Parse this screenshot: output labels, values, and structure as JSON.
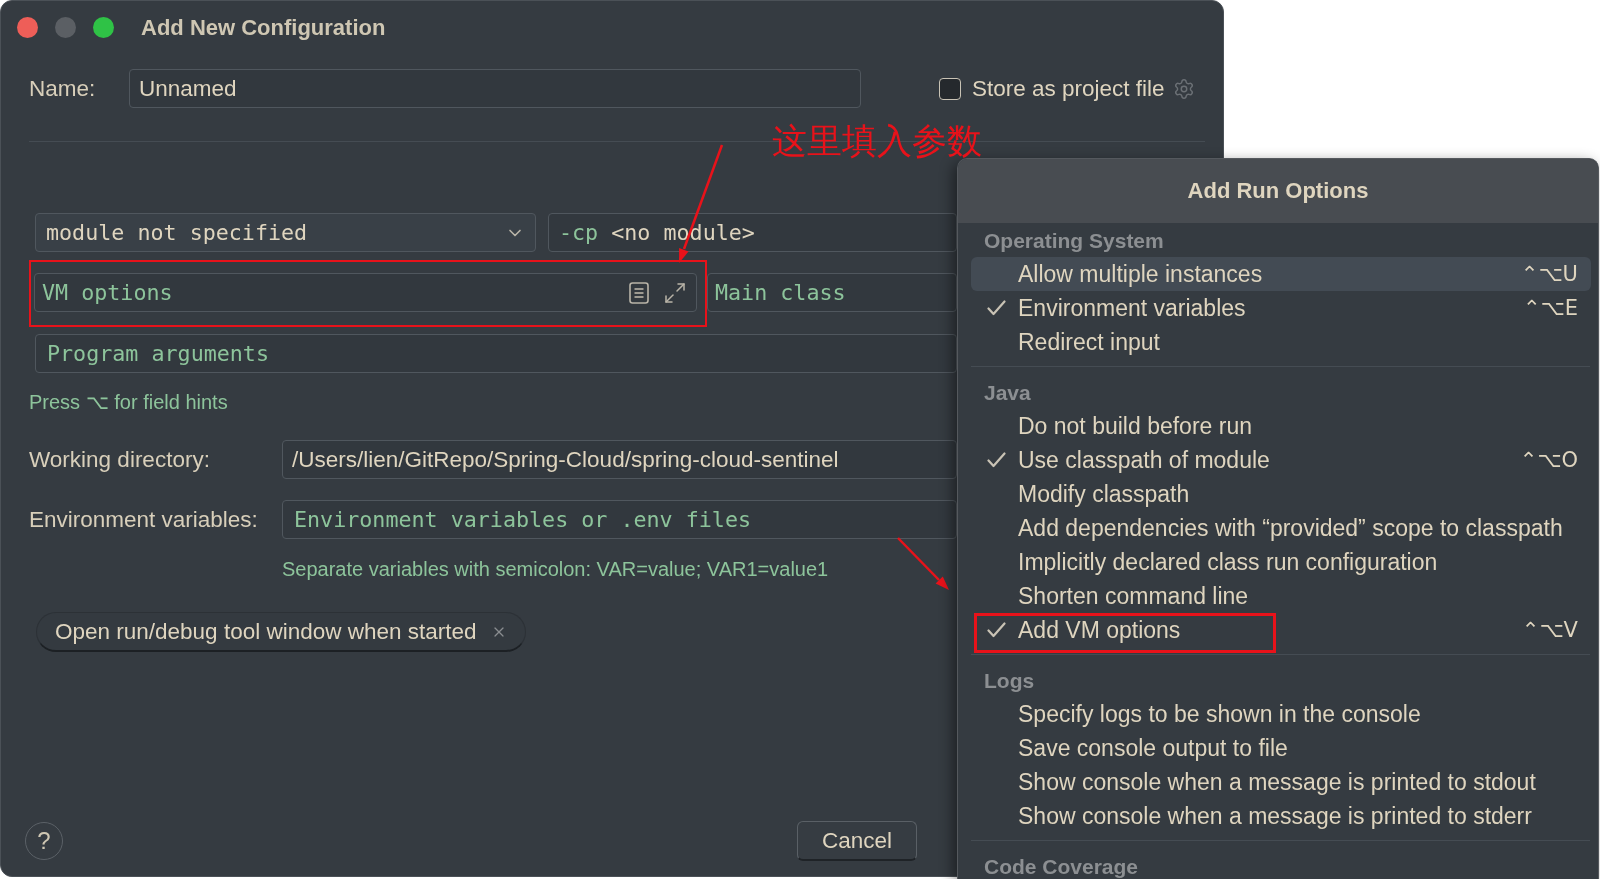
{
  "window": {
    "title": "Add New Configuration",
    "controls": [
      {
        "kind": "close",
        "disabled": false
      },
      {
        "kind": "minimize",
        "disabled": true
      },
      {
        "kind": "zoom",
        "disabled": false
      }
    ]
  },
  "name_field": {
    "label": "Name:",
    "value": "Unnamed"
  },
  "store_as_project_file": {
    "label": "Store as project file",
    "checked": false
  },
  "annotation": {
    "text": "这里填入参数"
  },
  "module_select": {
    "value": "module not specified"
  },
  "classpath_field": {
    "flag": "-cp",
    "value": "<no module>"
  },
  "vm_options_field": {
    "placeholder": "VM options",
    "annotated": true
  },
  "main_class_field": {
    "placeholder": "Main class"
  },
  "program_arguments_field": {
    "placeholder": "Program arguments"
  },
  "field_hints_note": "Press ⌥ for field hints",
  "working_directory": {
    "label": "Working directory:",
    "value": "/Users/lien/GitRepo/Spring-Cloud/spring-cloud-sentinel"
  },
  "environment_variables": {
    "label": "Environment variables:",
    "placeholder": "Environment variables or .env files",
    "hint": "Separate variables with semicolon: VAR=value; VAR1=value1"
  },
  "option_chips": [
    {
      "label": "Open run/debug tool window when started"
    }
  ],
  "help_button": {
    "label": "?"
  },
  "buttons": [
    {
      "label": "Cancel"
    }
  ],
  "run_options": {
    "title": "Add Run Options",
    "groups": [
      {
        "title": "Operating System",
        "items": [
          {
            "label": "Allow multiple instances",
            "shortcut": "⌃⌥U",
            "selected": true,
            "checked": false,
            "annotated": false
          },
          {
            "label": "Environment variables",
            "shortcut": "⌃⌥E",
            "selected": false,
            "checked": true,
            "annotated": false
          },
          {
            "label": "Redirect input",
            "selected": false,
            "checked": false,
            "annotated": false
          }
        ]
      },
      {
        "title": "Java",
        "items": [
          {
            "label": "Do not build before run",
            "selected": false,
            "checked": false,
            "annotated": false
          },
          {
            "label": "Use classpath of module",
            "shortcut": "⌃⌥O",
            "selected": false,
            "checked": true,
            "annotated": false
          },
          {
            "label": "Modify classpath",
            "selected": false,
            "checked": false,
            "annotated": false
          },
          {
            "label": "Add dependencies with “provided” scope to classpath",
            "selected": false,
            "checked": false,
            "annotated": false
          },
          {
            "label": "Implicitly declared class run configuration",
            "selected": false,
            "checked": false,
            "annotated": false
          },
          {
            "label": "Shorten command line",
            "selected": false,
            "checked": false,
            "annotated": false
          },
          {
            "label": "Add VM options",
            "shortcut": "⌃⌥V",
            "selected": false,
            "checked": true,
            "annotated": true
          }
        ]
      },
      {
        "title": "Logs",
        "items": [
          {
            "label": "Specify logs to be shown in the console",
            "selected": false,
            "checked": false,
            "annotated": false
          },
          {
            "label": "Save console output to file",
            "selected": false,
            "checked": false,
            "annotated": false
          },
          {
            "label": "Show console when a message is printed to stdout",
            "selected": false,
            "checked": false,
            "annotated": false
          },
          {
            "label": "Show console when a message is printed to stderr",
            "selected": false,
            "checked": false,
            "annotated": false
          }
        ]
      },
      {
        "title": "Code Coverage"
      }
    ]
  }
}
